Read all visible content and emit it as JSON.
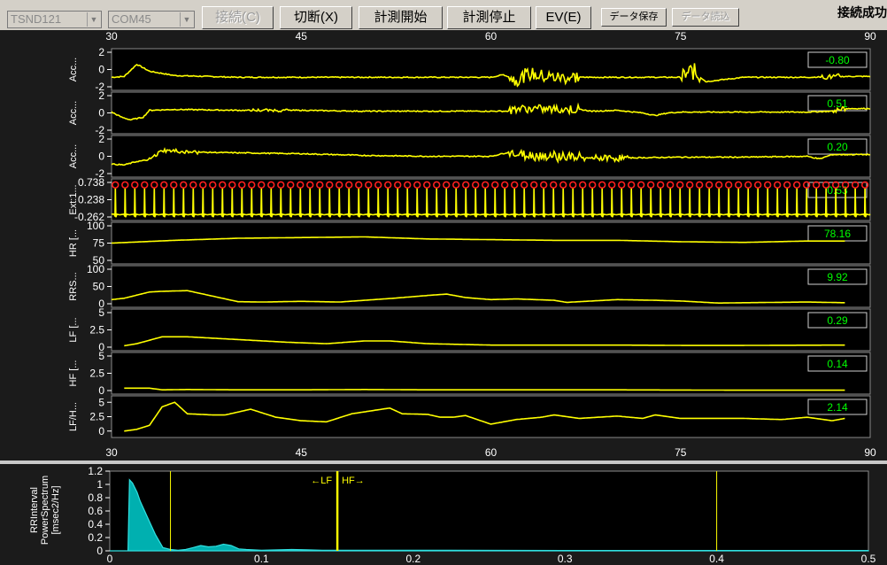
{
  "toolbar": {
    "device_combo": "TSND121",
    "port_combo": "COM45",
    "connect_label": "接続(C)",
    "disconnect_label": "切断(X)",
    "start_label": "計測開始",
    "stop_label": "計測停止",
    "ev_label": "EV(E)",
    "save_label": "データ保存",
    "load_label": "データ読込",
    "status": "接続成功"
  },
  "colors": {
    "background": "#000000",
    "trace": "#ffff00",
    "peak_marker": "#ff2020",
    "value_text": "#00ff00",
    "spectrum_fill": "#00b0b0"
  },
  "time_axis": {
    "min": 30,
    "max": 90,
    "ticks": [
      "30",
      "45",
      "60",
      "75",
      "90"
    ],
    "tick_values": [
      30,
      45,
      60,
      75,
      90
    ]
  },
  "chart_data": [
    {
      "type": "line",
      "label": "Acc...",
      "value": "-0.80",
      "ylim": [
        -2,
        2
      ],
      "yticks": [
        "2",
        "0",
        "-2"
      ],
      "ytick_values": [
        2,
        0,
        -2
      ],
      "baseline": -0.8,
      "x": [
        30,
        31,
        32,
        33,
        35,
        40,
        50,
        60,
        61,
        62,
        63,
        65,
        70,
        75,
        76,
        77,
        80,
        85,
        88,
        90
      ],
      "y": [
        -0.9,
        -0.8,
        0.6,
        -0.2,
        -0.7,
        -0.9,
        -0.9,
        -0.9,
        -0.6,
        -1.2,
        -0.5,
        -0.9,
        -0.9,
        -0.9,
        -0.2,
        -1.4,
        -0.9,
        -0.9,
        -0.8,
        -0.8
      ],
      "noise_regions": [
        [
          61.5,
          67,
          0.8
        ],
        [
          75,
          76.5,
          1.1
        ],
        [
          86,
          87.5,
          0.3
        ]
      ]
    },
    {
      "type": "line",
      "label": "Acc...",
      "value": "0.51",
      "ylim": [
        -2,
        2
      ],
      "yticks": [
        "2",
        "0",
        "-2"
      ],
      "ytick_values": [
        2,
        0,
        -2
      ],
      "x": [
        30,
        30.8,
        31.5,
        32.5,
        33,
        35,
        40,
        45,
        50,
        55,
        60,
        61.5,
        62,
        67,
        68,
        70,
        72,
        73,
        74,
        75,
        80,
        85,
        87,
        88,
        90
      ],
      "y": [
        0.1,
        -0.5,
        -0.8,
        -0.5,
        0.3,
        0.4,
        0.3,
        0.3,
        0.2,
        0.2,
        0.2,
        0.2,
        0.5,
        0.4,
        0.2,
        0.3,
        0.0,
        -0.3,
        0.0,
        0.1,
        0.1,
        0.1,
        0.2,
        0.5,
        0.5
      ],
      "noise_regions": [
        [
          61.5,
          67,
          0.5
        ],
        [
          41,
          44,
          0.15
        ],
        [
          87,
          88,
          0.3
        ]
      ]
    },
    {
      "type": "line",
      "label": "Acc...",
      "value": "0.20",
      "ylim": [
        -2,
        2
      ],
      "yticks": [
        "2",
        "0",
        "-2"
      ],
      "ytick_values": [
        2,
        0,
        -2
      ],
      "x": [
        30,
        31,
        32,
        33,
        34,
        36,
        40,
        45,
        50,
        55,
        60,
        61.5,
        62,
        66,
        67,
        70,
        75,
        80,
        85,
        86,
        87,
        88,
        90
      ],
      "y": [
        -0.9,
        -1.0,
        -0.6,
        -0.4,
        0.7,
        0.5,
        0.4,
        0.3,
        0.1,
        0.0,
        0.0,
        0.5,
        0.2,
        0.0,
        -0.2,
        -0.2,
        -0.1,
        -0.1,
        0.0,
        -0.3,
        0.2,
        0.2,
        0.2
      ],
      "noise_regions": [
        [
          61.5,
          67.5,
          0.6
        ],
        [
          33,
          37,
          0.2
        ],
        [
          68,
          71,
          0.35
        ]
      ]
    },
    {
      "type": "ecg",
      "label": "Ext:1...",
      "value": "0.53",
      "ylim": [
        -0.262,
        0.738
      ],
      "yticks": [
        "0.738",
        "0.238",
        "-0.262"
      ],
      "ytick_values": [
        0.738,
        0.238,
        -0.262
      ],
      "beat_interval": 0.77,
      "beat_start": 30.3,
      "peak_value": 0.59,
      "baseline_value": -0.22
    },
    {
      "type": "line",
      "label": "HR [...",
      "value": "78.16",
      "ylim": [
        50,
        100
      ],
      "yticks": [
        "100",
        "75",
        "50"
      ],
      "ytick_values": [
        100,
        75,
        50
      ],
      "x": [
        30,
        35,
        40,
        45,
        50,
        55,
        60,
        65,
        70,
        75,
        80,
        85,
        88
      ],
      "y": [
        75,
        79,
        82,
        83,
        84,
        81,
        80,
        79,
        79,
        77,
        76,
        78,
        78
      ]
    },
    {
      "type": "line",
      "label": "RRS...",
      "value": "9.92",
      "ylim": [
        0,
        100
      ],
      "yticks": [
        "100",
        "50",
        "0"
      ],
      "ytick_values": [
        100,
        50,
        0
      ],
      "x": [
        30,
        31,
        33,
        34,
        36,
        38,
        40,
        42,
        45,
        48,
        50,
        52,
        55,
        56.5,
        58,
        60,
        62,
        65,
        66,
        70,
        73,
        75,
        77,
        78,
        80,
        85,
        88
      ],
      "y": [
        12,
        16,
        34,
        36,
        38,
        22,
        6,
        5,
        7,
        5,
        10,
        15,
        24,
        28,
        18,
        12,
        14,
        10,
        4,
        12,
        10,
        8,
        4,
        2,
        3,
        5,
        3
      ]
    },
    {
      "type": "line",
      "label": "LF [...",
      "value": "0.29",
      "ylim": [
        0,
        5
      ],
      "yticks": [
        "5",
        "2.5",
        "0"
      ],
      "ytick_values": [
        5,
        2.5,
        0
      ],
      "x": [
        31,
        32,
        33,
        34,
        36,
        38,
        40,
        44,
        47,
        50,
        52,
        55,
        60,
        65,
        70,
        75,
        80,
        88
      ],
      "y": [
        0.2,
        0.5,
        1.0,
        1.5,
        1.5,
        1.3,
        1.1,
        0.7,
        0.5,
        0.9,
        0.9,
        0.5,
        0.3,
        0.3,
        0.3,
        0.25,
        0.25,
        0.3
      ]
    },
    {
      "type": "line",
      "label": "HF [...",
      "value": "0.14",
      "ylim": [
        0,
        5
      ],
      "yticks": [
        "5",
        "2.5",
        "0"
      ],
      "ytick_values": [
        5,
        2.5,
        0
      ],
      "x": [
        31,
        33,
        34,
        36,
        40,
        45,
        50,
        55,
        60,
        70,
        80,
        88
      ],
      "y": [
        0.35,
        0.35,
        0.1,
        0.15,
        0.1,
        0.1,
        0.15,
        0.1,
        0.1,
        0.1,
        0.05,
        0.05
      ]
    },
    {
      "type": "line",
      "label": "LF/H...",
      "value": "2.14",
      "ylim": [
        -0.5,
        5.5
      ],
      "yticks": [
        "5",
        "2.5",
        "0"
      ],
      "ytick_values": [
        5,
        2.5,
        0
      ],
      "x": [
        31,
        32,
        33,
        34,
        35,
        36,
        38,
        39,
        41,
        43,
        45,
        47,
        49,
        52,
        53,
        55,
        56,
        57,
        58,
        60,
        62,
        64,
        65,
        67,
        70,
        72,
        73,
        75,
        77,
        80,
        83,
        85,
        87,
        88
      ],
      "y": [
        0.0,
        0.3,
        1.0,
        4.2,
        5.0,
        3.0,
        2.8,
        2.8,
        3.8,
        2.4,
        1.8,
        1.6,
        3.0,
        4.0,
        3.0,
        2.9,
        2.4,
        2.4,
        2.7,
        1.2,
        2.0,
        2.4,
        2.8,
        2.2,
        2.6,
        2.2,
        2.8,
        2.2,
        2.2,
        2.2,
        2.0,
        2.4,
        1.8,
        2.2
      ]
    },
    {
      "type": "area",
      "label": "RRInterval PowerSpectrum [msec2/Hz]",
      "xlim": [
        0,
        0.5
      ],
      "ylim": [
        0,
        1.2
      ],
      "xticks": [
        "0",
        "0.1",
        "0.2",
        "0.3",
        "0.4",
        "0.5"
      ],
      "xtick_values": [
        0,
        0.1,
        0.2,
        0.3,
        0.4,
        0.5
      ],
      "yticks": [
        "1.2",
        "1",
        "0.8",
        "0.6",
        "0.4",
        "0.2",
        "0"
      ],
      "ytick_values": [
        1.2,
        1,
        0.8,
        0.6,
        0.4,
        0.2,
        0
      ],
      "x": [
        0.0,
        0.012,
        0.013,
        0.015,
        0.018,
        0.02,
        0.025,
        0.03,
        0.035,
        0.04,
        0.045,
        0.05,
        0.055,
        0.06,
        0.065,
        0.07,
        0.075,
        0.08,
        0.085,
        0.09,
        0.1,
        0.12,
        0.13,
        0.14,
        0.2,
        0.3,
        0.4,
        0.5
      ],
      "y": [
        0,
        0,
        1.07,
        1.02,
        0.88,
        0.75,
        0.5,
        0.25,
        0.05,
        0.02,
        0.01,
        0.02,
        0.05,
        0.08,
        0.06,
        0.07,
        0.1,
        0.08,
        0.03,
        0.02,
        0.01,
        0.02,
        0.015,
        0.01,
        0.01,
        0.005,
        0.005,
        0.005
      ],
      "markers": [
        {
          "x": 0.04,
          "label": ""
        },
        {
          "x": 0.15,
          "label": ""
        },
        {
          "x": 0.4,
          "label": ""
        }
      ],
      "lf_label": "←LF",
      "hf_label": "HF→"
    }
  ]
}
